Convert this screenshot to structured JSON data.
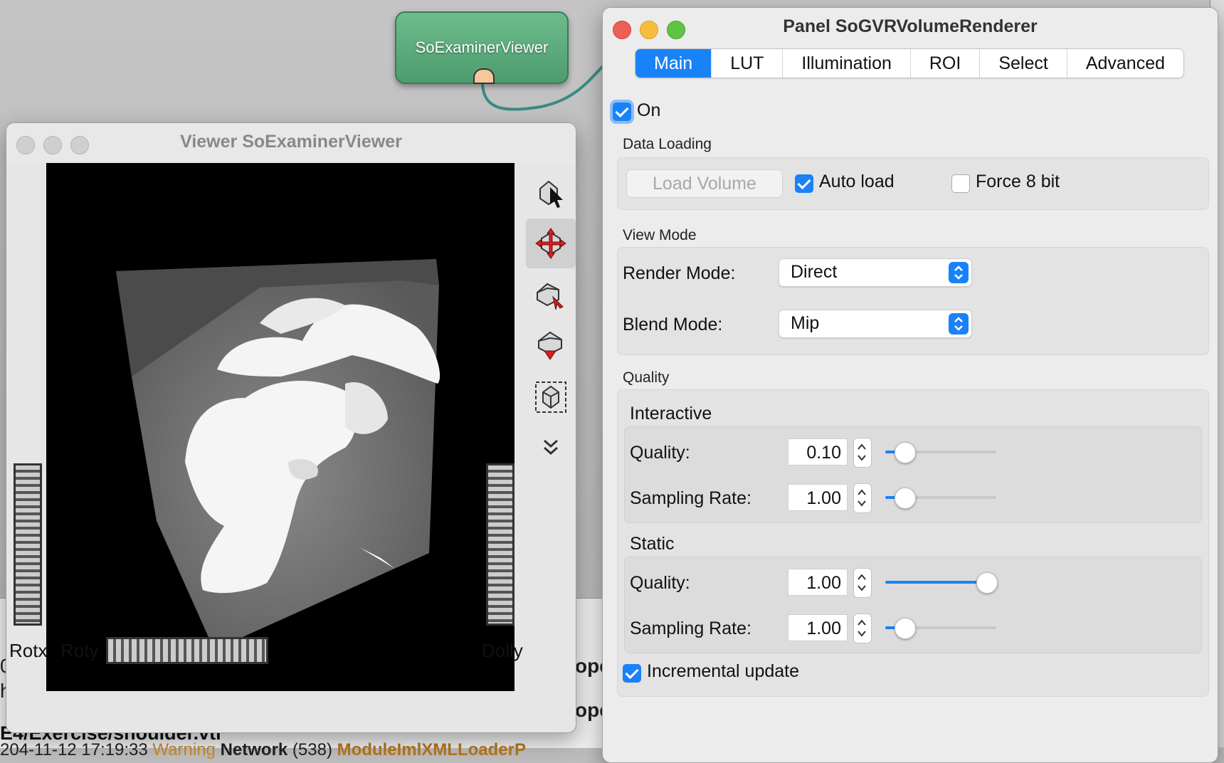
{
  "network": {
    "node_label": "SoExaminerViewer"
  },
  "console": {
    "left_fragments": [
      "0",
      "h"
    ],
    "right_fragments": [
      "ope",
      "ope"
    ],
    "path_text": "E4/Exercise/shoulder.vti",
    "log_prefix": "204-11-12 17:19:33",
    "log_warning": "Warning",
    "log_network": "Network",
    "log_code": "(538)",
    "log_module": "ModuleImlXMLLoaderP"
  },
  "viewer": {
    "title": "Viewer SoExaminerViewer",
    "tools": [
      {
        "icon": "pick-cursor-icon",
        "active": false
      },
      {
        "icon": "rotate-move-icon",
        "active": true
      },
      {
        "icon": "home-set-icon",
        "active": false
      },
      {
        "icon": "home-goto-icon",
        "active": false
      },
      {
        "icon": "view-all-icon",
        "active": false
      },
      {
        "icon": "chevron-double-down-icon",
        "active": false
      }
    ],
    "wheel_labels": {
      "rotx": "Rotx",
      "roty": "Roty",
      "dolly": "Dolly"
    }
  },
  "panel": {
    "title": "Panel SoGVRVolumeRenderer",
    "tabs": [
      {
        "label": "Main",
        "active": true
      },
      {
        "label": "LUT",
        "active": false
      },
      {
        "label": "Illumination",
        "active": false
      },
      {
        "label": "ROI",
        "active": false
      },
      {
        "label": "Select",
        "active": false
      },
      {
        "label": "Advanced",
        "active": false
      }
    ],
    "on": {
      "label": "On",
      "checked": true
    },
    "data_loading": {
      "label": "Data Loading",
      "load_button": "Load Volume",
      "auto_load": {
        "label": "Auto load",
        "checked": true
      },
      "force_8bit": {
        "label": "Force 8 bit",
        "checked": false
      }
    },
    "view_mode": {
      "label": "View Mode",
      "render_mode_label": "Render Mode:",
      "render_mode_value": "Direct",
      "blend_mode_label": "Blend Mode:",
      "blend_mode_value": "Mip"
    },
    "quality": {
      "label": "Quality",
      "interactive": {
        "label": "Interactive",
        "quality_label": "Quality:",
        "quality_value": "0.10",
        "quality_fraction": 0.1,
        "sampling_label": "Sampling Rate:",
        "sampling_value": "1.00",
        "sampling_fraction": 0.1
      },
      "static": {
        "label": "Static",
        "quality_label": "Quality:",
        "quality_value": "1.00",
        "quality_fraction": 1.0,
        "sampling_label": "Sampling Rate:",
        "sampling_value": "1.00",
        "sampling_fraction": 0.1
      }
    },
    "incremental_update": {
      "label": "Incremental update",
      "checked": true
    }
  },
  "colors": {
    "accent": "#1a82f7",
    "node_green": "#5aab7c",
    "connection": "#3b8a86"
  }
}
